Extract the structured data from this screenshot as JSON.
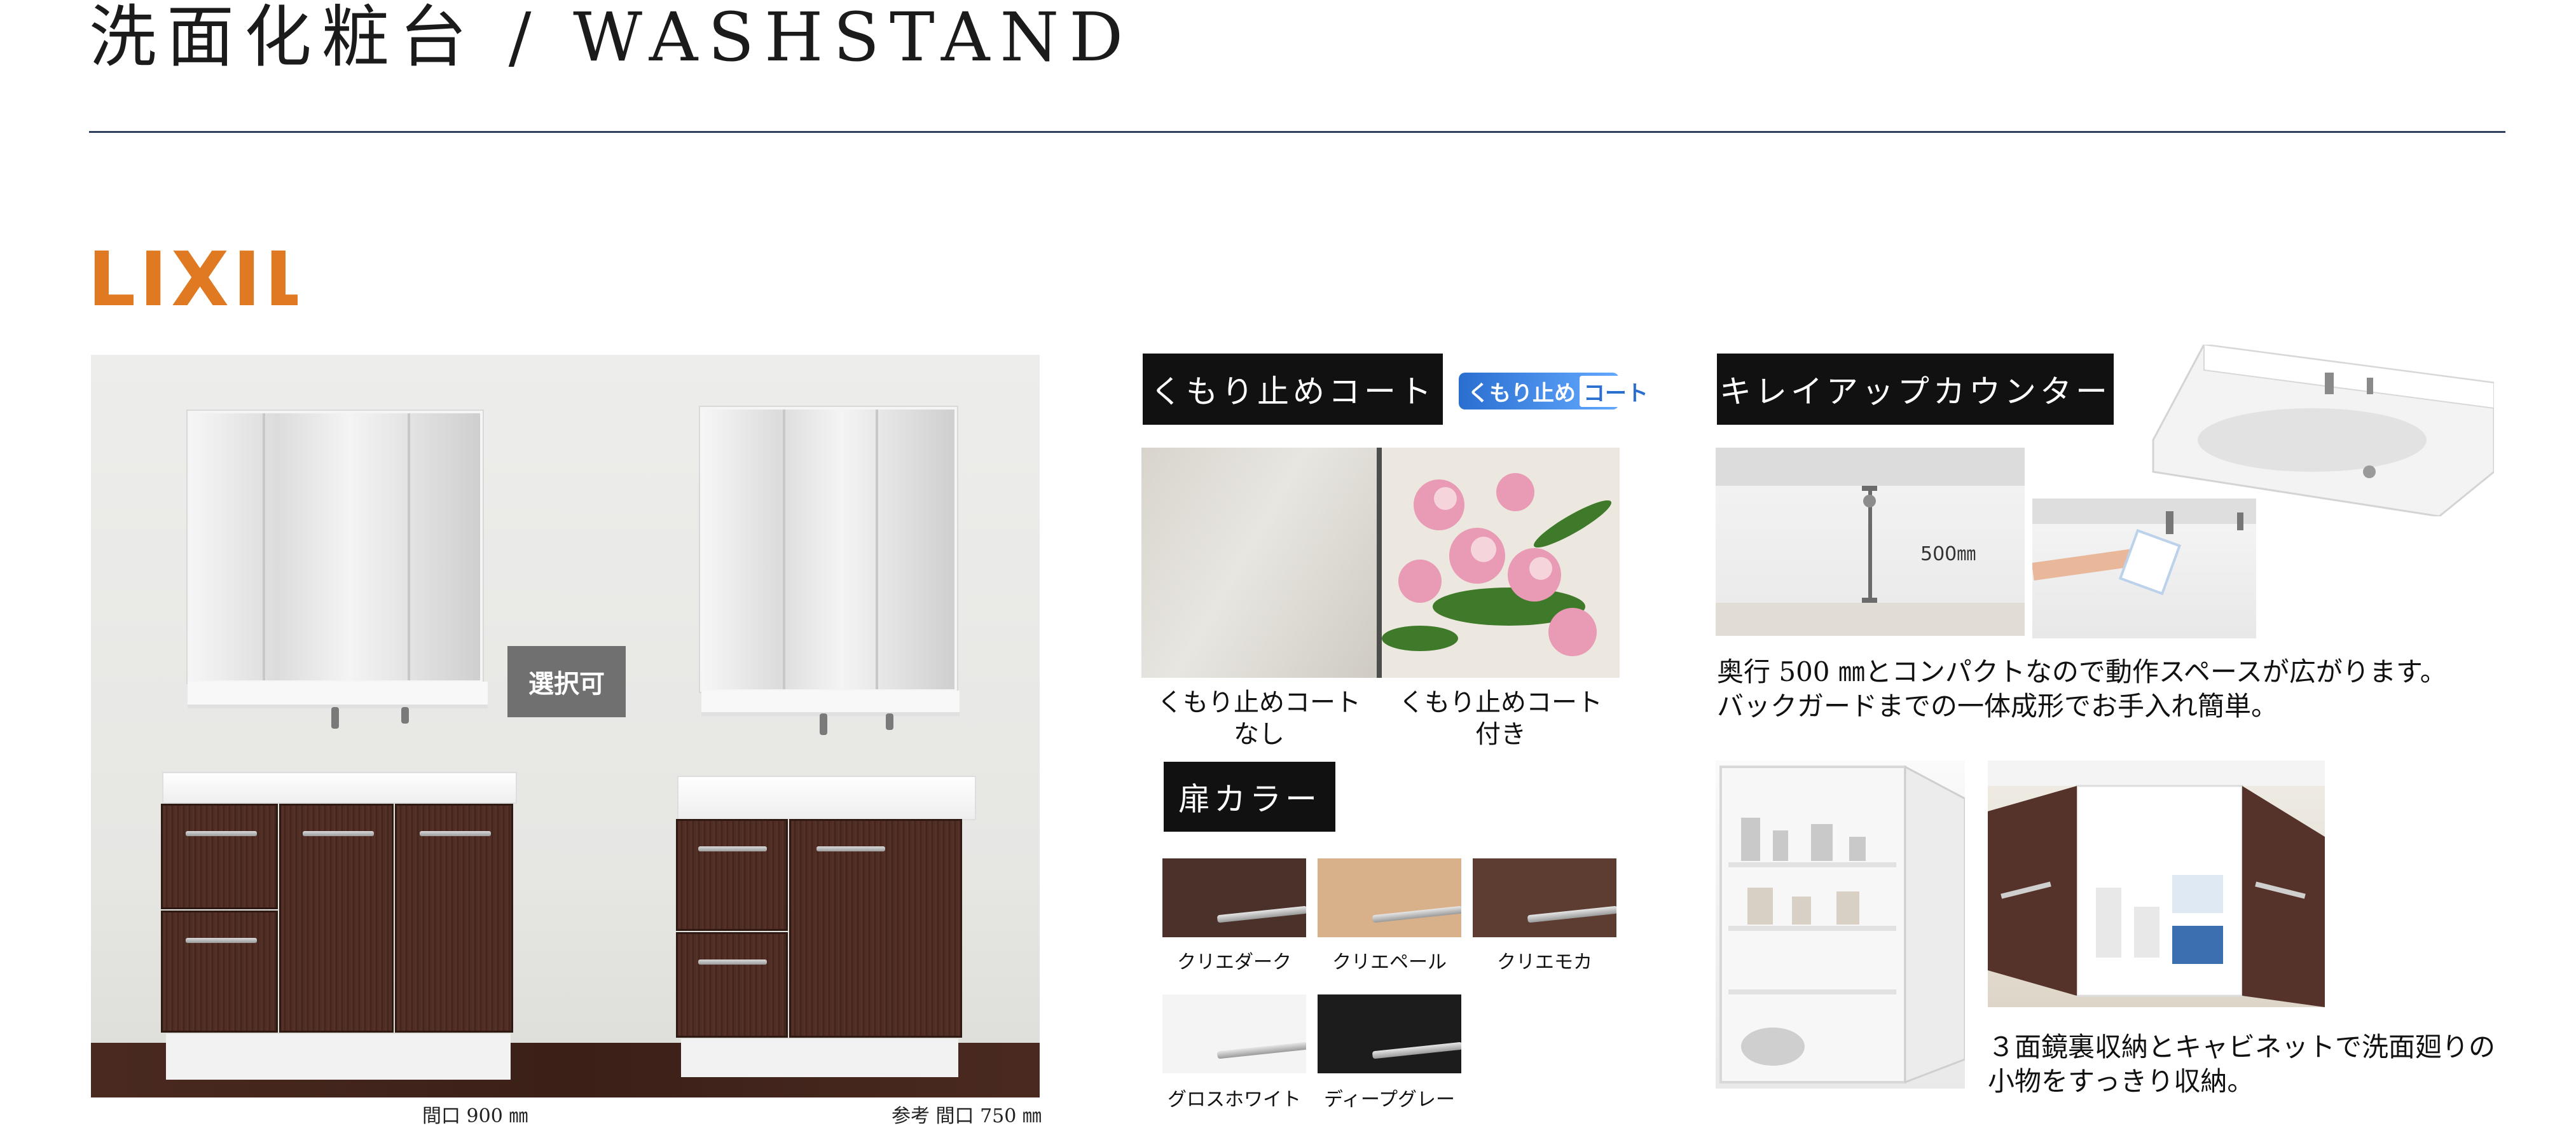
{
  "page": {
    "title": "洗面化粧台 / WASHSTAND"
  },
  "brand": {
    "logo_text": "LIXIL",
    "logo_color": "#e07a22"
  },
  "product_photo": {
    "selectable_badge": "選択可",
    "caption_900": "間口 900 ㎜",
    "caption_750": "参考 間口 750 ㎜"
  },
  "anti_fog": {
    "header": "くもり止めコート",
    "logo_part1": "くもり止め",
    "logo_part2": "コート",
    "caption_left_line1": "くもり止めコート",
    "caption_left_line2": "なし",
    "caption_right_line1": "くもり止めコート",
    "caption_right_line2": "付き"
  },
  "door_color": {
    "header": "扉カラー",
    "swatches": [
      {
        "label": "クリエダーク",
        "color": "#4a322a"
      },
      {
        "label": "クリエペール",
        "color": "#d8b08a"
      },
      {
        "label": "クリエモカ",
        "color": "#5d3d32"
      },
      {
        "label": "グロスホワイト",
        "color": "#f4f4f4"
      },
      {
        "label": "ディープグレー",
        "color": "#1c1c1c"
      }
    ]
  },
  "counter": {
    "header": "キレイアップカウンター",
    "depth_label": "500㎜",
    "description_line1": "奥行 500 ㎜とコンパクトなので動作スペースが広がります。",
    "description_line2": "バックガードまでの一体成形でお手入れ簡単。"
  },
  "storage": {
    "description_line1": "３面鏡裏収納とキャビネットで洗面廻りの",
    "description_line2": "小物をすっきり収納。"
  },
  "colors": {
    "rule": "#2f3f5f",
    "header_bg": "#111111"
  }
}
